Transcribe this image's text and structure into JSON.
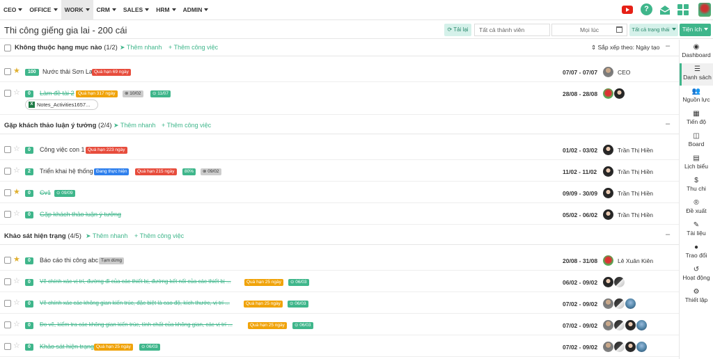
{
  "nav": {
    "menu": [
      {
        "label": "CEO"
      },
      {
        "label": "OFFICE"
      },
      {
        "label": "WORK"
      },
      {
        "label": "CRM"
      },
      {
        "label": "SALES"
      },
      {
        "label": "HRM"
      },
      {
        "label": "ADMIN"
      }
    ],
    "active": "WORK",
    "help": "?"
  },
  "page": {
    "title": "Thi công giếng gia lai - 200 cái"
  },
  "toolbar": {
    "reload": "Tải lại",
    "member_placeholder": "Tất cả thành viên",
    "time": "Mọi lúc",
    "status": "Tất cả trạng thái",
    "tienich": "Tiện ích"
  },
  "sidebar": {
    "items": [
      {
        "label": "Dashboard",
        "icon": "dashboard-icon"
      },
      {
        "label": "Danh sách",
        "icon": "list-icon"
      },
      {
        "label": "Nguồn lực",
        "icon": "users-icon"
      },
      {
        "label": "Tiến độ",
        "icon": "table-icon"
      },
      {
        "label": "Board",
        "icon": "board-icon"
      },
      {
        "label": "Lịch biểu",
        "icon": "calendar-icon"
      },
      {
        "label": "Thu chi",
        "icon": "dollar-icon"
      },
      {
        "label": "Đề xuất",
        "icon": "registered-icon"
      },
      {
        "label": "Tài liệu",
        "icon": "paperclip-icon"
      },
      {
        "label": "Trao đổi",
        "icon": "chat-icon"
      },
      {
        "label": "Hoạt động",
        "icon": "history-icon"
      },
      {
        "label": "Thiết lập",
        "icon": "gear-icon"
      }
    ]
  },
  "sections": [
    {
      "name": "Không thuộc hạng mục nào",
      "count": "(1/2)",
      "quick": "Thêm nhanh",
      "add": "Thêm công việc",
      "sort": "Sắp xếp theo: Ngày tạo",
      "collapse": "–",
      "tasks": [
        {
          "star": "on",
          "progress": "100",
          "name": "Nước thải Sơn La",
          "done": false,
          "tags": [
            {
              "text": "Quá hạn 69 ngày",
              "color": "red"
            }
          ],
          "dates": "07/07 - 07/07",
          "user": "CEO"
        },
        {
          "star": "off",
          "progress": "0",
          "name": "Làm đề tài 2",
          "done": true,
          "tags": [
            {
              "text": "Quá hạn 317 ngày",
              "color": "orange"
            },
            {
              "text": "⊗ 10/02",
              "color": "gray"
            },
            {
              "text": "⊙ 11/07",
              "color": "green"
            }
          ],
          "dates": "28/08 - 28/08",
          "user": "",
          "attachment": "Notes_Activities1657..."
        }
      ]
    },
    {
      "name": "Gặp khách thảo luận ý tưởng",
      "count": "(2/4)",
      "quick": "Thêm nhanh",
      "add": "Thêm công việc",
      "collapse": "–",
      "tasks": [
        {
          "star": "off",
          "progress": "0",
          "name": "Công việc con 1",
          "done": false,
          "tags": [
            {
              "text": "Quá hạn 223 ngày",
              "color": "red"
            }
          ],
          "dates": "01/02 - 03/02",
          "user": "Trần Thị Hiền"
        },
        {
          "star": "off",
          "progress": "2",
          "name": "Triển khai hệ thống",
          "done": false,
          "tags": [
            {
              "text": "Đang thực hiện",
              "color": "blue"
            },
            {
              "text": "Quá hạn 215 ngày",
              "color": "red"
            },
            {
              "text": "80%",
              "color": "green"
            },
            {
              "text": "⊗ 09/02",
              "color": "gray"
            }
          ],
          "dates": "11/02 - 11/02",
          "user": "Trần Thị Hiền"
        },
        {
          "star": "on",
          "progress": "0",
          "name": "Cv1",
          "done": true,
          "tags": [
            {
              "text": "⊙ 09/09",
              "color": "green"
            }
          ],
          "dates": "09/09 - 30/09",
          "user": "Trần Thị Hiền"
        },
        {
          "star": "off",
          "progress": "0",
          "name": "Gặp khách thảo luận ý tưởng",
          "done": true,
          "tags": [],
          "dates": "05/02 - 06/02",
          "user": "Trần Thị Hiền"
        }
      ]
    },
    {
      "name": "Khảo sát hiện trạng",
      "count": "(4/5)",
      "quick": "Thêm nhanh",
      "add": "Thêm công việc",
      "collapse": "–",
      "tasks": [
        {
          "star": "on",
          "progress": "0",
          "name": "Báo cáo thi công abc",
          "done": false,
          "tags": [
            {
              "text": "Tạm dừng",
              "color": "gray"
            }
          ],
          "dates": "20/08 - 31/08",
          "user": "Lê Xuân Kiên"
        },
        {
          "star": "off",
          "progress": "0",
          "name": "Vẽ chính xác vị trí, đường đi của các thiết bị, đường kết nối của các thiết bị ...",
          "done": true,
          "tags": [
            {
              "text": "Quá hạn 25 ngày",
              "color": "orange"
            },
            {
              "text": "⊙ 06/03",
              "color": "green"
            }
          ],
          "dates": "06/02 - 09/02",
          "user": ""
        },
        {
          "star": "off",
          "progress": "0",
          "name": "Vẽ chính xác các không gian kiến trúc, đặc biệt là cao độ, kích thước, vị trí ...",
          "done": true,
          "tags": [
            {
              "text": "Quá hạn 25 ngày",
              "color": "orange"
            },
            {
              "text": "⊙ 06/03",
              "color": "green"
            }
          ],
          "dates": "07/02 - 09/02",
          "user": ""
        },
        {
          "star": "off",
          "progress": "0",
          "name": "Đo vẽ, kiểm tra các không gian kiến trúc, tính chất của không gian, các vị trí ...",
          "done": true,
          "tags": [
            {
              "text": "Quá hạn 25 ngày",
              "color": "orange"
            },
            {
              "text": "⊙ 06/03",
              "color": "green"
            }
          ],
          "dates": "07/02 - 09/02",
          "user": ""
        },
        {
          "star": "off",
          "progress": "0",
          "name": "Khảo sát hiện trạng",
          "done": true,
          "tags": [
            {
              "text": "Quá hạn 25 ngày",
              "color": "orange"
            },
            {
              "text": "⊙ 06/03",
              "color": "green"
            }
          ],
          "dates": "07/02 - 09/02",
          "user": ""
        }
      ]
    }
  ]
}
